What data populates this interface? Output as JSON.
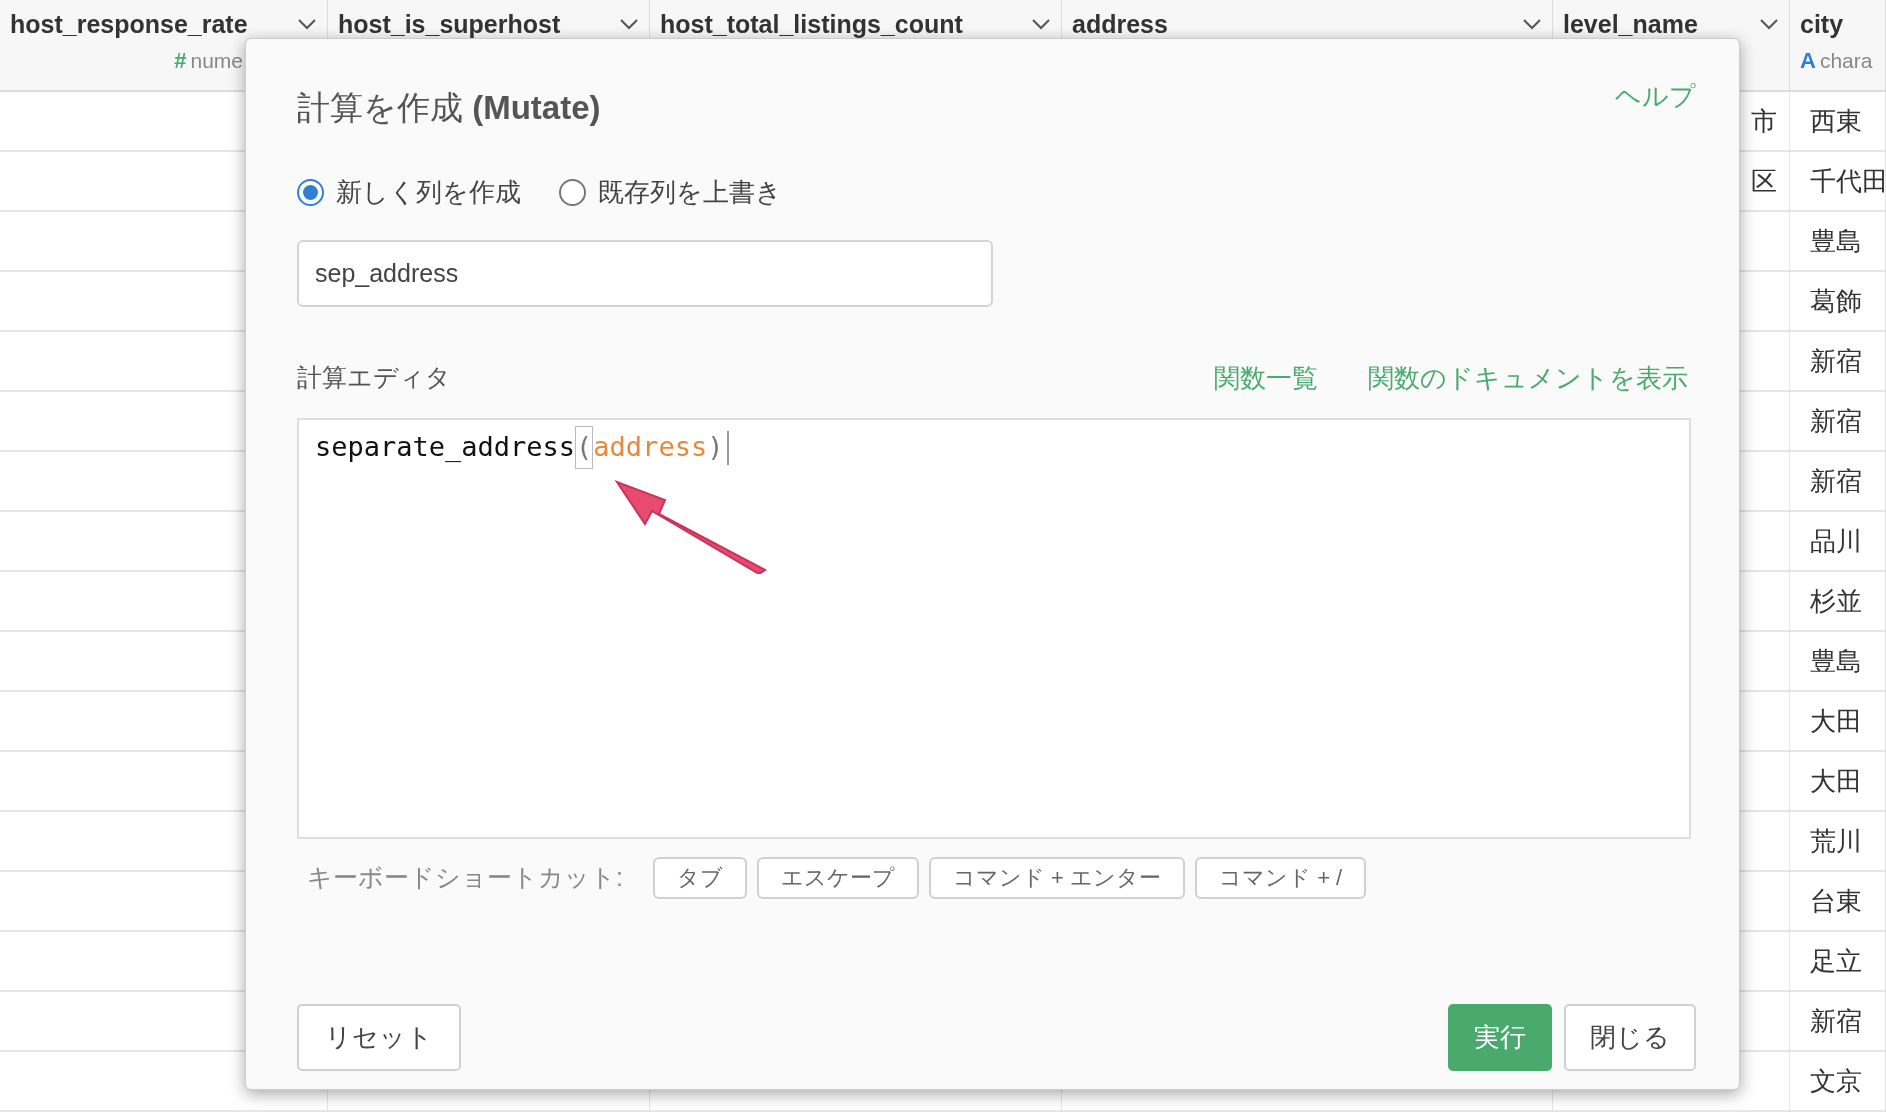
{
  "table": {
    "columns": [
      {
        "name": "host_response_rate",
        "type_icon": "#",
        "type_label": "nume",
        "color": "#4aa96c"
      },
      {
        "name": "host_is_superhost"
      },
      {
        "name": "host_total_listings_count"
      },
      {
        "name": "address"
      },
      {
        "name": "level_name"
      },
      {
        "name": "city",
        "type_icon": "A",
        "type_label": "chara",
        "color": "#2f7fd6"
      }
    ],
    "rows": [
      {
        "level_name": "市",
        "city": "西東"
      },
      {
        "level_name": "区",
        "city": "千代田"
      },
      {
        "city": "豊島"
      },
      {
        "city": "葛飾"
      },
      {
        "city": "新宿"
      },
      {
        "city": "新宿"
      },
      {
        "city": "新宿"
      },
      {
        "city": "品川"
      },
      {
        "city": "杉並"
      },
      {
        "city": "豊島"
      },
      {
        "city": "大田"
      },
      {
        "city": "大田"
      },
      {
        "city": "荒川"
      },
      {
        "city": "台東"
      },
      {
        "city": "足立"
      },
      {
        "city": "新宿"
      },
      {
        "city": "文京"
      }
    ]
  },
  "dialog": {
    "title": "計算を作成 **(Mutate)**",
    "help": "ヘルプ",
    "modes": [
      {
        "label": "新しく列を作成",
        "selected": true
      },
      {
        "label": "既存列を上書き",
        "selected": false
      }
    ],
    "column_name": "sep_address",
    "editor_label": "計算エディタ",
    "links": [
      "関数一覧",
      "関数のドキュメントを表示"
    ],
    "code": {
      "function": "separate_address",
      "open": "(",
      "argument": "address",
      "close": ")"
    },
    "shortcuts_label": "キーボードショートカット:",
    "shortcuts": [
      "タブ",
      "エスケープ",
      "コマンド + エンター",
      "コマンド + /"
    ],
    "reset": "リセット",
    "run": "実行",
    "close": "閉じる"
  }
}
